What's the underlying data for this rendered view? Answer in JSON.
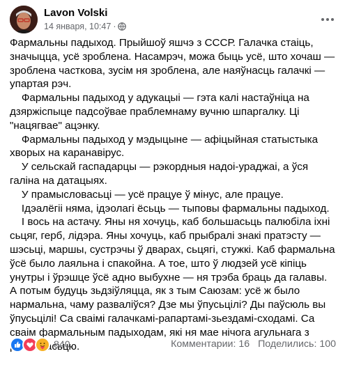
{
  "post": {
    "author": "Lavon Volski",
    "timestamp": "14 января, 10:47",
    "paragraphs": [
      "Фармальны падыход. Прыйшоў яшчэ з СССР. Галачка стаіць, значыцца, усё зроблена. Насамрэч, можа быць усё, што хочаш — зроблена часткова, зусім ня зроблена, але наяўнасць галачкі — упартая рэч.",
      "    Фармальны падыход у адукацыі — гэта калі настаўніца на дзярж­іспыце падсоўвае праблемнаму вучню шпаргалку. Ці \"нацягвае\" ацэнку.",
      "    Фармальны падыход у мэдыцыне — афіцыйная статыстыка хворых на каранавірус.",
      "    У сельскай гаспадарцы — рэкордныя надоі-ураджаі, а ўся галіна на датацыях.",
      "    У прамысловасьці — усё працуе ў мінус, але працуе.",
      "    Ідэалёгіі няма, ідэолагі ёсьць — тыповы фармальны падыход.",
      "    І вось на астачу. Яны ня хочуць, каб большасьць палюбіла іхні сьцяг, герб, лідэра. Яны хочуць, каб прыбралі знакі пратэсту — шэсьці, маршы, сустрэчы ў дварах, сьцягі, стужкі. Каб фармальна ўсё было лаяльна і спакойна. А тое, што ў людзей усё кіпіць унутры і ўрэшце ўсё адно выбухне — ня трэба браць да галавы. А потым будуць зьдзіўляцца, як з тым Саюзам: усё ж было нармальна, чаму разваліўся? Дзе мы ўпусьцілі? Ды паўсюль вы ўпусьцілі! Са сваімі галачкамі-рапартамі-зьездамі-сходамі. Са сваім фармальным падыходам, які ня мае нічога агульнага з рэчаіснасьцю."
    ],
    "reaction_count": "840",
    "comments": "Комментарии: 16",
    "shares": "Поделились: 100",
    "reaction_icons": [
      "like-icon",
      "love-icon",
      "care-icon"
    ],
    "colors": {
      "like": "#1877f2",
      "love": "#f33e58",
      "care": "#f7b125",
      "meta": "#65676b"
    }
  }
}
